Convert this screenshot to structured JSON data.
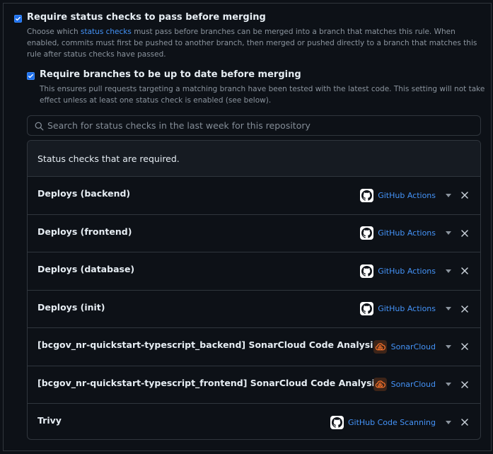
{
  "options": [
    {
      "title": "Require status checks to pass before merging",
      "checked": true,
      "desc_before": "Choose which ",
      "desc_link": "status checks",
      "desc_after": " must pass before branches can be merged into a branch that matches this rule. When enabled, commits must first be pushed to another branch, then merged or pushed directly to a branch that matches this rule after status checks have passed."
    },
    {
      "title": "Require branches to be up to date before merging",
      "checked": true,
      "desc": "This ensures pull requests targeting a matching branch have been tested with the latest code. This setting will not take effect unless at least one status check is enabled (see below)."
    }
  ],
  "search": {
    "placeholder": "Search for status checks in the last week for this repository",
    "value": ""
  },
  "panel": {
    "header": "Status checks that are required.",
    "checks": [
      {
        "name": "Deploys (backend)",
        "app": "GitHub Actions",
        "icon": "github-icon"
      },
      {
        "name": "Deploys (frontend)",
        "app": "GitHub Actions",
        "icon": "github-icon"
      },
      {
        "name": "Deploys (database)",
        "app": "GitHub Actions",
        "icon": "github-icon"
      },
      {
        "name": "Deploys (init)",
        "app": "GitHub Actions",
        "icon": "github-icon"
      },
      {
        "name": "[bcgov_nr-quickstart-typescript_backend] SonarCloud Code Analysis",
        "app": "SonarCloud",
        "icon": "sonarcloud-icon"
      },
      {
        "name": "[bcgov_nr-quickstart-typescript_frontend] SonarCloud Code Analysis",
        "app": "SonarCloud",
        "icon": "sonarcloud-icon"
      },
      {
        "name": "Trivy",
        "app": "GitHub Code Scanning",
        "icon": "github-icon"
      }
    ]
  },
  "colors": {
    "background": "#0d1117",
    "border": "#30363d",
    "accent": "#4493f8",
    "checkbox": "#1f6feb",
    "muted": "#8b949e"
  }
}
